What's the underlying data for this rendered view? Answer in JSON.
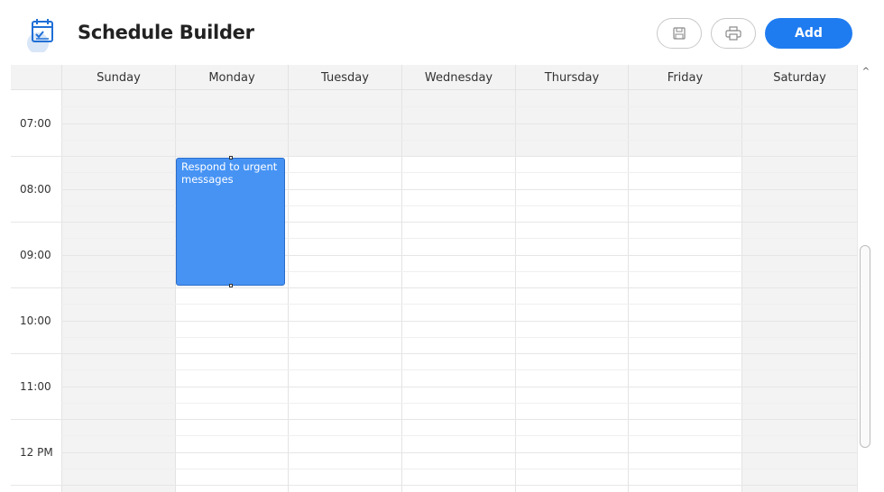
{
  "header": {
    "title": "Schedule Builder",
    "add_label": "Add"
  },
  "days": [
    "Sunday",
    "Monday",
    "Tuesday",
    "Wednesday",
    "Thursday",
    "Friday",
    "Saturday"
  ],
  "times": [
    "07:00",
    "08:00",
    "09:00",
    "10:00",
    "11:00",
    "12 PM"
  ],
  "event": {
    "title": "Respond to urgent messages",
    "day": "Monday",
    "start": "07:30",
    "end": "09:30",
    "color": "#4693f4"
  },
  "colors": {
    "accent": "#1f7cf0",
    "shaded_column": "#f3f3f4"
  }
}
